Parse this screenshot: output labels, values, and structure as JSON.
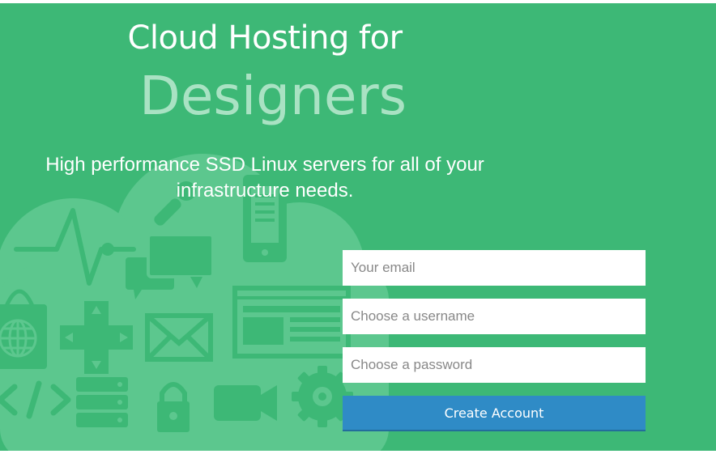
{
  "hero": {
    "title_line1": "Cloud Hosting for",
    "title_line2": "Designers",
    "subtitle": "High performance SSD Linux servers for all of your infrastructure needs."
  },
  "signup_form": {
    "email_placeholder": "Your email",
    "username_placeholder": "Choose a username",
    "password_placeholder": "Choose a password",
    "submit_label": "Create Account"
  },
  "colors": {
    "background": "#3db876",
    "illustration": "#5cc78e",
    "title_accent": "#a9e2c3",
    "button": "#2f8bc6"
  },
  "illustration_icons": [
    "cloud-icon",
    "heartbeat-icon",
    "chat-icon",
    "phone-icon",
    "shopping-bag-icon",
    "globe-icon",
    "dpad-icon",
    "envelope-icon",
    "browser-window-icon",
    "code-icon",
    "server-icon",
    "lock-icon",
    "video-camera-icon",
    "gear-icon",
    "wrench-icon"
  ]
}
